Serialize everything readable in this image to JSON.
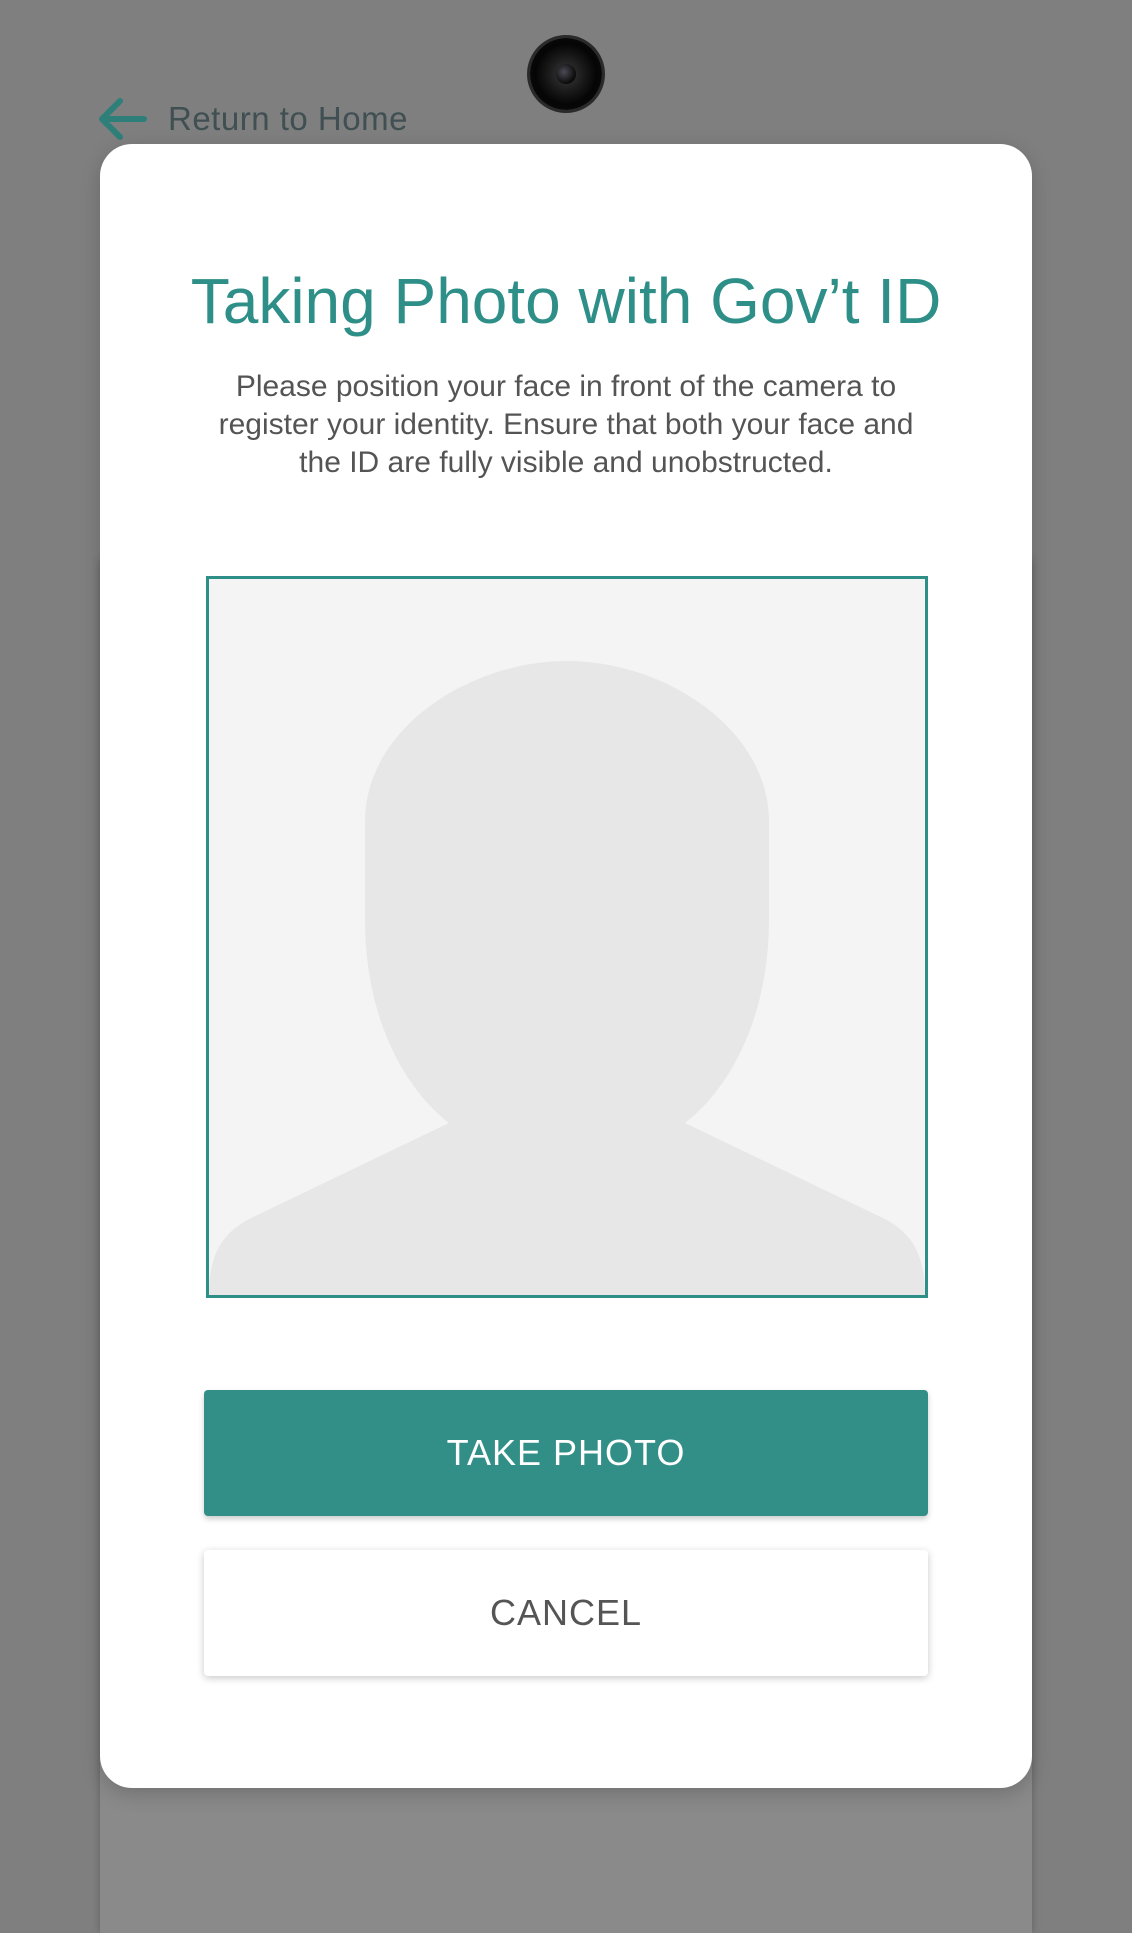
{
  "nav": {
    "back_label": "Return to Home",
    "back_icon": "arrow-left-icon"
  },
  "modal": {
    "title": "Taking Photo with Gov’t ID",
    "instructions": "Please position your face in front of the camera to register your identity. Ensure that both your face and the ID are fully visible and unobstructed.",
    "placeholder_icon": "person-silhouette-icon",
    "take_photo_label": "TAKE PHOTO",
    "cancel_label": "CANCEL"
  },
  "colors": {
    "accent": "#2e8f88",
    "overlay": "#7f7f7f",
    "placeholder_bg": "#f4f4f4",
    "silhouette": "#e7e7e7"
  }
}
